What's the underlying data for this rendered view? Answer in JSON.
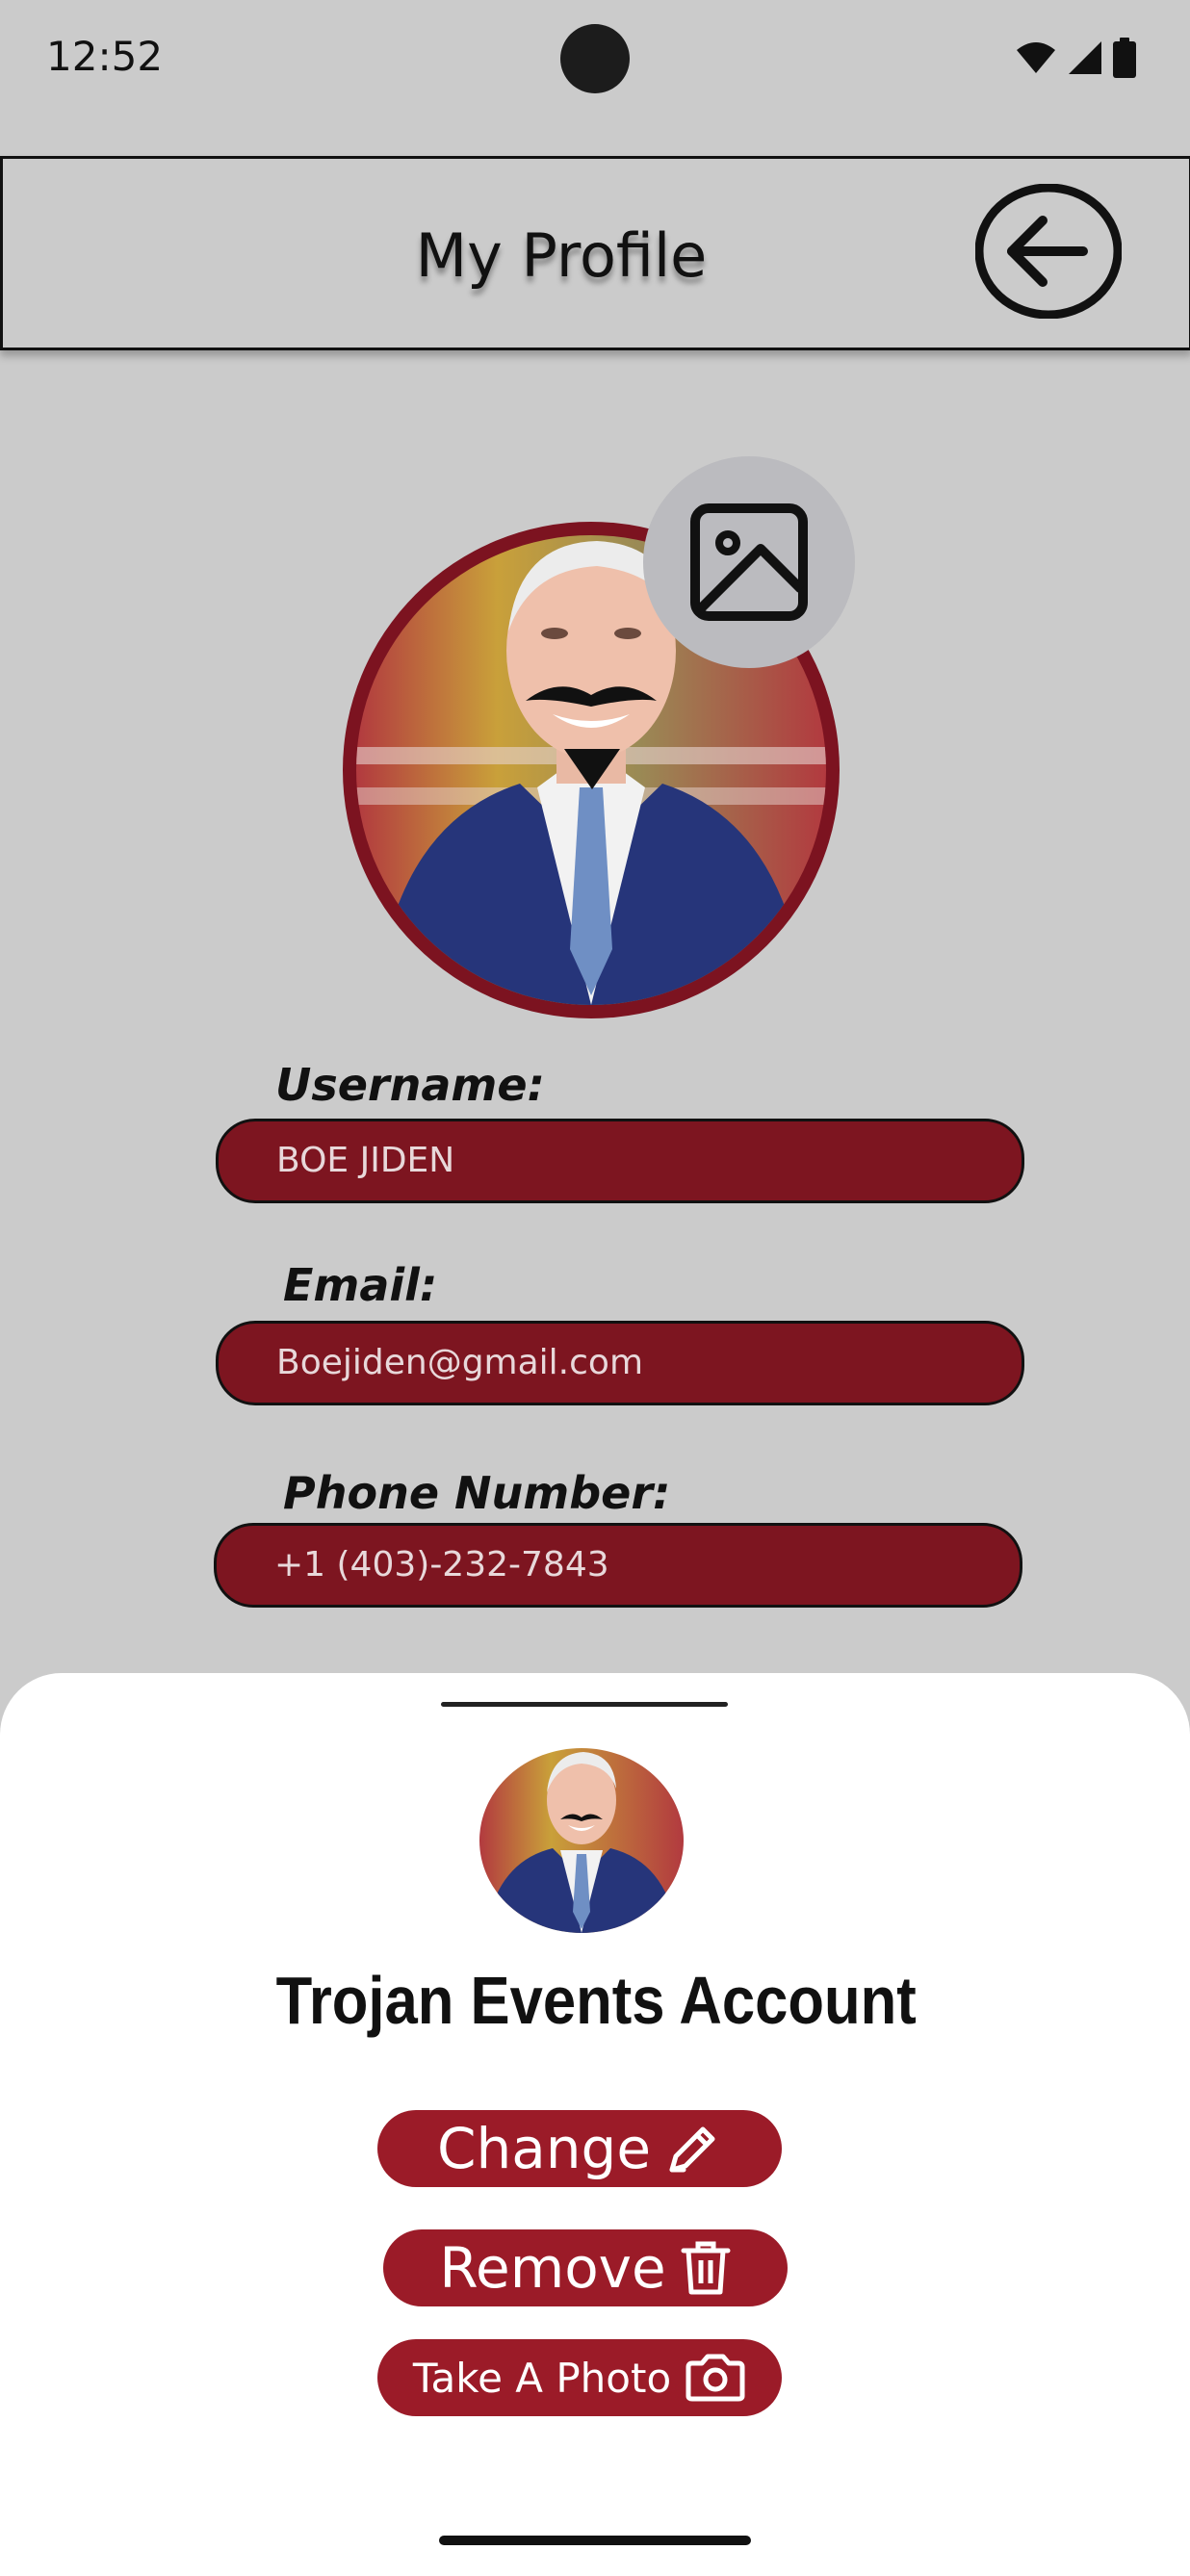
{
  "status_bar": {
    "time": "12:52",
    "icons": [
      "wifi-icon",
      "signal-icon",
      "battery-icon"
    ]
  },
  "app_bar": {
    "title": "My Profile",
    "back_icon": "arrow-left-circle-icon"
  },
  "profile": {
    "image_picker_icon": "image-icon",
    "username_label": "Username:",
    "username_value": "BOE JIDEN",
    "email_label": "Email:",
    "email_value": "Boejiden@gmail.com",
    "phone_label": "Phone Number:",
    "phone_value": "+1 (403)-232-7843"
  },
  "sheet": {
    "title": "Trojan Events Account",
    "change_label": "Change",
    "change_icon": "pencil-icon",
    "remove_label": "Remove",
    "remove_icon": "trash-icon",
    "photo_label": "Take A Photo",
    "photo_icon": "camera-icon"
  },
  "colors": {
    "background": "#cbcbcb",
    "field_fill": "#7d1520",
    "button_fill": "#9b1b28",
    "avatar_ring": "#7c1320",
    "sheet_background": "#ffffff"
  }
}
